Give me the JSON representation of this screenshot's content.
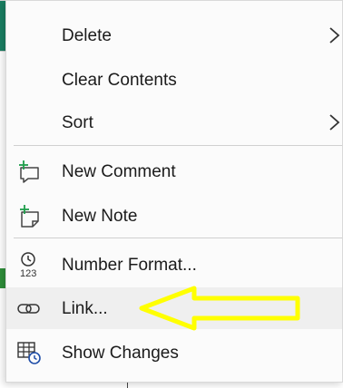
{
  "menu": {
    "items": [
      {
        "label": "Delete",
        "icon": null,
        "submenu": true
      },
      {
        "label": "Clear Contents",
        "icon": null,
        "submenu": false
      },
      {
        "label": "Sort",
        "icon": null,
        "submenu": true
      },
      {
        "label": "New Comment",
        "icon": "new-comment-icon",
        "submenu": false
      },
      {
        "label": "New Note",
        "icon": "new-note-icon",
        "submenu": false
      },
      {
        "label": "Number Format...",
        "icon": "number-format-icon",
        "submenu": false
      },
      {
        "label": "Link...",
        "icon": "link-icon",
        "submenu": false
      },
      {
        "label": "Show Changes",
        "icon": "show-changes-icon",
        "submenu": false
      }
    ],
    "hovered_item": "Link..."
  },
  "annotation": {
    "type": "arrow",
    "color": "#ffff00",
    "points_to": "Link..."
  },
  "colors": {
    "accent_green": "#1f9e4b",
    "icon_blue": "#1f4ea8",
    "text": "#1b1b1b"
  }
}
